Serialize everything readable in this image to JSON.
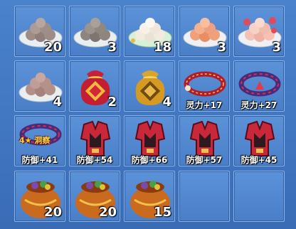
{
  "inventory": {
    "slots": [
      {
        "name": "ball-dish-grey",
        "icon": "dumpling-plate-icon",
        "count": "20"
      },
      {
        "name": "ball-dish-grey-2",
        "icon": "dumpling-plate-icon",
        "count": "3"
      },
      {
        "name": "ball-dish-white",
        "icon": "dumpling-plate-icon",
        "count": "18"
      },
      {
        "name": "ball-dish-orange",
        "icon": "dumpling-plate-icon",
        "count": "3"
      },
      {
        "name": "ball-dish-pink",
        "icon": "dumpling-plate-icon",
        "count": "3"
      },
      {
        "name": "ball-dish-brown",
        "icon": "dumpling-plate-icon",
        "count": "4"
      },
      {
        "name": "lucky-bag-red",
        "icon": "lucky-bag-icon",
        "count": "2"
      },
      {
        "name": "lucky-bag-gold",
        "icon": "lucky-bag-icon",
        "count": "4"
      },
      {
        "name": "bracelet-red",
        "icon": "bracelet-icon",
        "stat": "灵力+17"
      },
      {
        "name": "bracelet-purple",
        "icon": "bracelet-icon",
        "stat": "灵力+27"
      },
      {
        "name": "bracelet-purple-2",
        "icon": "bracelet-icon",
        "stat": "防御+41",
        "tag_star": "4★",
        "tag_text": "洞察"
      },
      {
        "name": "armor-1",
        "icon": "armor-icon",
        "stat": "防御+54"
      },
      {
        "name": "armor-2",
        "icon": "armor-icon",
        "stat": "防御+66"
      },
      {
        "name": "armor-3",
        "icon": "armor-icon",
        "stat": "防御+57"
      },
      {
        "name": "armor-4",
        "icon": "armor-icon",
        "stat": "防御+45"
      },
      {
        "name": "treasure-bag-1",
        "icon": "treasure-bag-icon",
        "count": "20"
      },
      {
        "name": "treasure-bag-2",
        "icon": "treasure-bag-icon",
        "count": "20"
      },
      {
        "name": "treasure-bag-3",
        "icon": "treasure-bag-icon",
        "count": "15"
      },
      {
        "name": "empty-1",
        "icon": ""
      },
      {
        "name": "empty-2",
        "icon": ""
      }
    ]
  },
  "colors": {
    "panel": "#3f73bd",
    "slot": "#5c92d8",
    "border": "#8db4e8",
    "armor_red": "#c8283a",
    "gold": "#ffd44a"
  }
}
